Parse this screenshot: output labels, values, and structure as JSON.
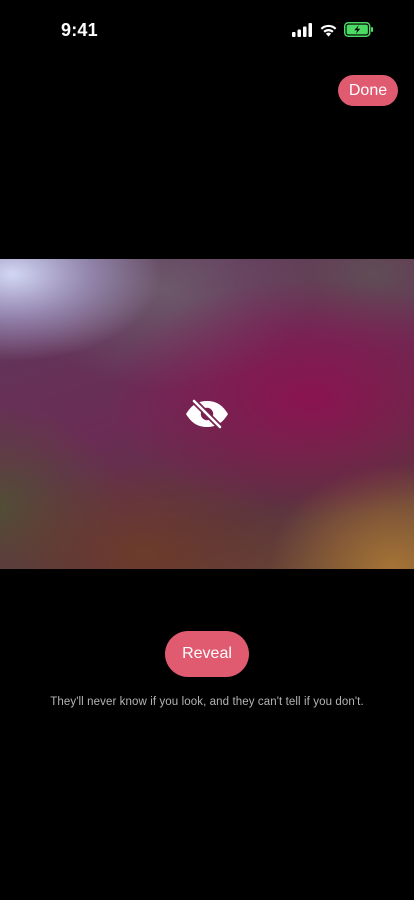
{
  "status_bar": {
    "time": "9:41",
    "icons": [
      "signal-icon",
      "wifi-icon",
      "battery-charging-icon"
    ],
    "battery_color": "#4cd964"
  },
  "toolbar": {
    "done_label": "Done"
  },
  "media": {
    "state": "hidden",
    "overlay_icon": "eye-slash-icon"
  },
  "actions": {
    "reveal_label": "Reveal",
    "hint": "They'll never know if you look, and they can't tell if you don't."
  },
  "colors": {
    "accent": "#e05a70",
    "background": "#000000",
    "hint_text": "#b4b4b4"
  }
}
